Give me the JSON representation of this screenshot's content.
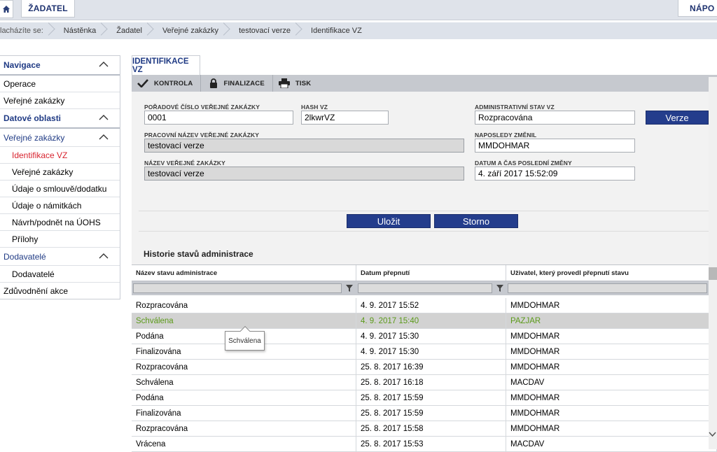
{
  "top": {
    "home_icon": "home-icon",
    "zadatel_label": "ŽADATEL",
    "help_label": "NÁPO"
  },
  "breadcrumb": {
    "prefix": "lacházíte se:",
    "items": [
      "Nástěnka",
      "Žadatel",
      "Veřejné zakázky",
      "testovací verze",
      "Identifikace VZ"
    ]
  },
  "sidebar": {
    "navigace": "Navigace",
    "operace": "Operace",
    "verejne_zakazky_top": "Veřejné zakázky",
    "datove_oblasti": "Datové oblasti",
    "verejne_zakazky_group": "Veřejné zakázky",
    "identifikace_vz": "Identifikace VZ",
    "verejne_zakazky_sub": "Veřejné zakázky",
    "udaje_smlouve": "Údaje o smlouvě/dodatku",
    "udaje_namitkach": "Údaje o námitkách",
    "navrh_podnet": "Návrh/podnět na ÚOHS",
    "prilohy": "Přílohy",
    "dodavatele_group": "Dodavatelé",
    "dodavatele_sub": "Dodavatelé",
    "zduvodneni_akce": "Zdůvodnění akce"
  },
  "tab": {
    "label": "IDENTIFIKACE VZ"
  },
  "toolbar": {
    "kontrola": "KONTROLA",
    "finalizace": "FINALIZACE",
    "tisk": "TISK"
  },
  "form": {
    "poradove_label": "POŘADOVÉ ČÍSLO VEŘEJNÉ ZAKÁZKY",
    "poradove_value": "0001",
    "hash_label": "HASH VZ",
    "hash_value": "2lkwrVZ",
    "admin_stav_label": "ADMINISTRATIVNÍ STAV VZ",
    "admin_stav_value": "Rozpracována",
    "verze_button": "Verze",
    "pracovni_nazev_label": "PRACOVNÍ NÁZEV VEŘEJNÉ ZAKÁZKY",
    "pracovni_nazev_value": "testovací verze",
    "naposledy_zmenil_label": "NAPOSLEDY ZMĚNIL",
    "naposledy_zmenil_value": "MMDOHMAR",
    "nazev_label": "NÁZEV VEŘEJNÉ ZAKÁZKY",
    "nazev_value": "testovací verze",
    "datum_label": "DATUM A ČAS POSLEDNÍ ZMĚNY",
    "datum_value": "4. září 2017 15:52:09",
    "ulozit": "Uložit",
    "storno": "Storno"
  },
  "history": {
    "title": "Historie stavů administrace",
    "columns": [
      "Název stavu administrace",
      "Datum přepnutí",
      "Uživatel, který provedl přepnutí stavu"
    ],
    "rows": [
      [
        "Rozpracována",
        "4. 9. 2017 15:52",
        "MMDOHMAR"
      ],
      [
        "Schválena",
        "4. 9. 2017 15:40",
        "PAZJAR"
      ],
      [
        "Podána",
        "4. 9. 2017 15:30",
        "MMDOHMAR"
      ],
      [
        "Finalizována",
        "4. 9. 2017 15:30",
        "MMDOHMAR"
      ],
      [
        "Rozpracována",
        "25. 8. 2017 16:39",
        "MMDOHMAR"
      ],
      [
        "Schválena",
        "25. 8. 2017 16:18",
        "MACDAV"
      ],
      [
        "Podána",
        "25. 8. 2017 15:59",
        "MMDOHMAR"
      ],
      [
        "Finalizována",
        "25. 8. 2017 15:59",
        "MMDOHMAR"
      ],
      [
        "Rozpracována",
        "25. 8. 2017 15:58",
        "MMDOHMAR"
      ],
      [
        "Vrácena",
        "25. 8. 2017 15:53",
        "MACDAV"
      ]
    ],
    "tooltip": "Schválena"
  },
  "colors": {
    "accent_blue": "#243d8c",
    "nav_blue": "#1f3a84",
    "active_red": "#d8242f",
    "selected_green": "#5c9a1a"
  }
}
